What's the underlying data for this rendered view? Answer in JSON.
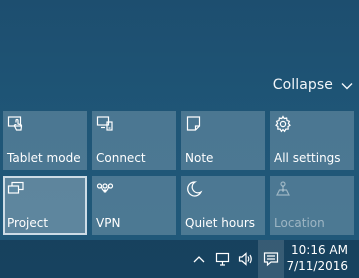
{
  "header": {
    "collapse_label": "Collapse"
  },
  "quick_actions": [
    {
      "label": "Tablet mode",
      "icon": "tablet-mode-icon",
      "state": "normal"
    },
    {
      "label": "Connect",
      "icon": "connect-icon",
      "state": "normal"
    },
    {
      "label": "Note",
      "icon": "note-icon",
      "state": "normal"
    },
    {
      "label": "All settings",
      "icon": "gear-icon",
      "state": "normal"
    },
    {
      "label": "Project",
      "icon": "project-icon",
      "state": "selected"
    },
    {
      "label": "VPN",
      "icon": "vpn-icon",
      "state": "normal"
    },
    {
      "label": "Quiet hours",
      "icon": "moon-icon",
      "state": "normal"
    },
    {
      "label": "Location",
      "icon": "location-icon",
      "state": "disabled"
    }
  ],
  "taskbar": {
    "tray_icons": [
      "chevron-up-icon",
      "network-icon",
      "volume-icon",
      "action-center-icon"
    ],
    "time": "10:16 AM",
    "date": "7/11/2016"
  },
  "colors": {
    "background": "#1f5677",
    "tile": "#4c7893",
    "tile_selected_outline": "#e1ebf2"
  }
}
